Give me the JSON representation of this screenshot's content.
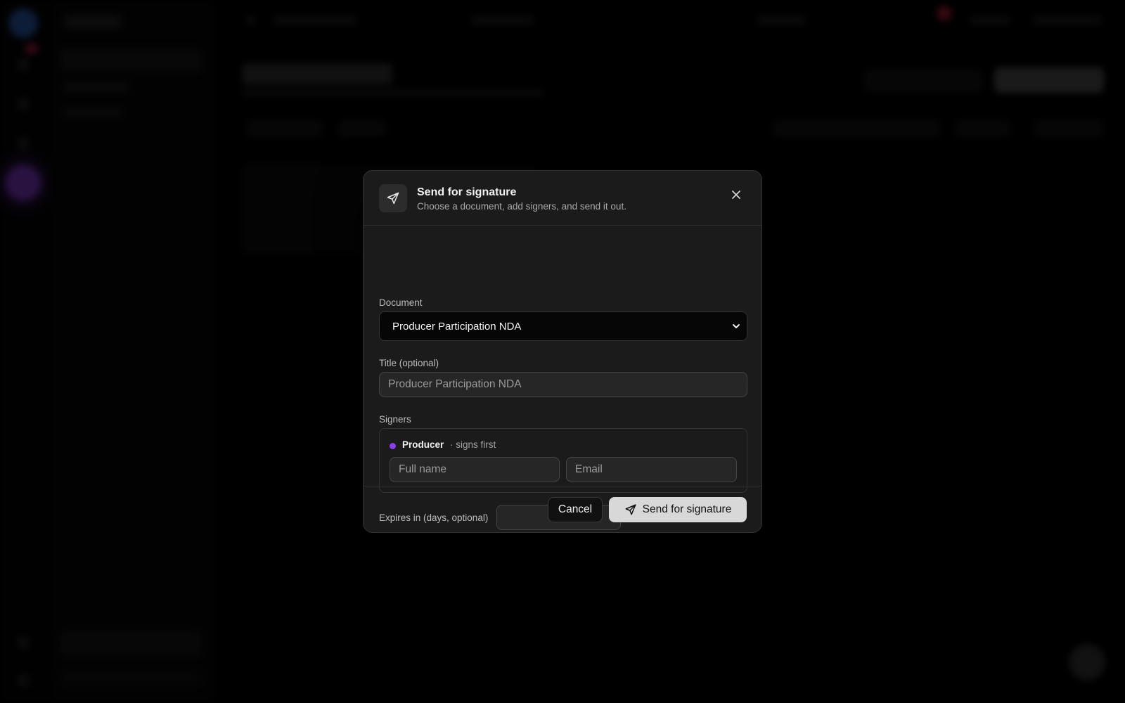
{
  "modal": {
    "title": "Send for signature",
    "subtitle": "Choose a document, add signers, and send it out.",
    "icon": "send-icon",
    "close_icon": "close-icon"
  },
  "document": {
    "label": "Document",
    "selected": "Producer Participation NDA"
  },
  "title_field": {
    "label": "Title (optional)",
    "placeholder": "Producer Participation NDA",
    "value": ""
  },
  "signers": {
    "label": "Signers",
    "items": [
      {
        "role": "Producer",
        "order_note": "· signs first",
        "dot_color": "#8a3fe8",
        "name_placeholder": "Full name",
        "email_placeholder": "Email"
      }
    ]
  },
  "expires": {
    "label": "Expires in (days, optional)",
    "value": ""
  },
  "footer": {
    "cancel_label": "Cancel",
    "send_label": "Send for signature",
    "send_icon": "send-icon"
  },
  "colors": {
    "accent_dot": "#8a3fe8",
    "primary_button": "#d8d8d8",
    "modal_bg": "#1b1b1b"
  }
}
